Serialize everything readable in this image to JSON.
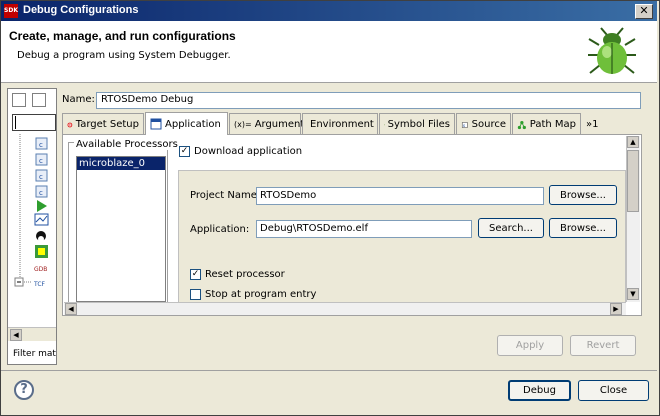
{
  "window": {
    "title": "Debug Configurations",
    "app_badge": "SDK",
    "close_glyph": "✕"
  },
  "banner": {
    "title": "Create, manage, and run configurations",
    "subtitle": "Debug a program using System Debugger."
  },
  "left_panel": {
    "filter_text": "Filter mat",
    "tree_icons": [
      "c-app-icon",
      "c-app-icon",
      "c-app-icon",
      "c-app-icon",
      "launch-icon",
      "chart-icon",
      "linux-icon",
      "device-icon",
      "gdb-icon",
      "tcf-icon"
    ]
  },
  "config": {
    "name_label": "Name:",
    "name_value": "RTOSDemo Debug"
  },
  "tabs": [
    {
      "label": "Target Setup",
      "active": false
    },
    {
      "label": "Application",
      "active": true
    },
    {
      "label": "Arguments",
      "prefix": "(x)=",
      "active": false
    },
    {
      "label": "Environment",
      "active": false
    },
    {
      "label": "Symbol Files",
      "active": false
    },
    {
      "label": "Source",
      "active": false
    },
    {
      "label": "Path Map",
      "active": false
    },
    {
      "label": "»1",
      "active": false
    }
  ],
  "processors": {
    "legend": "Available Processors",
    "items": [
      "microblaze_0"
    ]
  },
  "application": {
    "download_label": "Download application",
    "download_checked": "✓",
    "project_label": "Project Name:",
    "project_value": "RTOSDemo",
    "browse_label": "Browse...",
    "app_label": "Application:",
    "app_value": "Debug\\RTOSDemo.elf",
    "search_label": "Search...",
    "reset_label": "Reset processor",
    "reset_checked": "✓",
    "stop_label": "Stop at program entry",
    "stop_checked": ""
  },
  "buttons": {
    "apply": "Apply",
    "revert": "Revert",
    "debug": "Debug",
    "close": "Close",
    "help": "?"
  }
}
